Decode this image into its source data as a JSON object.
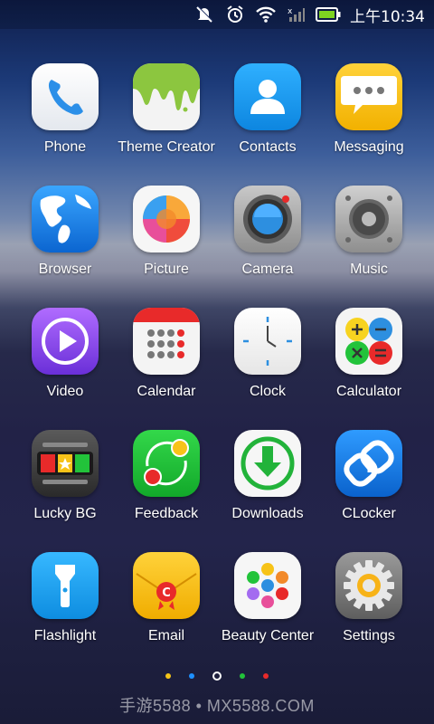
{
  "status_bar": {
    "time": "上午10:34",
    "icons": [
      "mute-icon",
      "alarm-icon",
      "wifi-icon",
      "signal-icon",
      "battery-icon"
    ],
    "battery_color": "#7ed321"
  },
  "apps": [
    {
      "label": "Phone",
      "icon": "phone-icon",
      "color": "#2b8fe8"
    },
    {
      "label": "Theme Creator",
      "icon": "theme-creator-icon",
      "color": "#8cc63f"
    },
    {
      "label": "Contacts",
      "icon": "contacts-icon",
      "color": "#1a9cf0"
    },
    {
      "label": "Messaging",
      "icon": "messaging-icon",
      "color": "#f7c318"
    },
    {
      "label": "Browser",
      "icon": "globe-icon",
      "color": "#1e7fe0"
    },
    {
      "label": "Picture",
      "icon": "picture-icon",
      "color": "#f04c3c"
    },
    {
      "label": "Camera",
      "icon": "camera-icon",
      "color": "#2d8fe0"
    },
    {
      "label": "Music",
      "icon": "speaker-icon",
      "color": "#8a8a8a"
    },
    {
      "label": "Video",
      "icon": "play-icon",
      "color": "#8a4de8"
    },
    {
      "label": "Calendar",
      "icon": "calendar-icon",
      "color": "#e82a2a"
    },
    {
      "label": "Clock",
      "icon": "clock-icon",
      "color": "#ffffff"
    },
    {
      "label": "Calculator",
      "icon": "calculator-icon",
      "color": "#f7d320"
    },
    {
      "label": "Lucky BG",
      "icon": "slot-machine-icon",
      "color": "#3b3b3b"
    },
    {
      "label": "Feedback",
      "icon": "feedback-icon",
      "color": "#22c33a"
    },
    {
      "label": "Downloads",
      "icon": "download-icon",
      "color": "#22b33a"
    },
    {
      "label": "CLocker",
      "icon": "lock-link-icon",
      "color": "#1d7fe0"
    },
    {
      "label": "Flashlight",
      "icon": "flashlight-icon",
      "color": "#1fa8f0"
    },
    {
      "label": "Email",
      "icon": "email-icon",
      "color": "#f7c318"
    },
    {
      "label": "Beauty Center",
      "icon": "beauty-center-icon",
      "color": "#ffffff"
    },
    {
      "label": "Settings",
      "icon": "gear-icon",
      "color": "#8a8a8a"
    }
  ],
  "page_indicator": {
    "current_page": 3,
    "total_pages": 5,
    "colors": [
      "#f5c518",
      "#1e90ff",
      "#ffffff",
      "#22c33a",
      "#e82a2a"
    ]
  },
  "watermark": "手游5588 • MX5588.COM"
}
